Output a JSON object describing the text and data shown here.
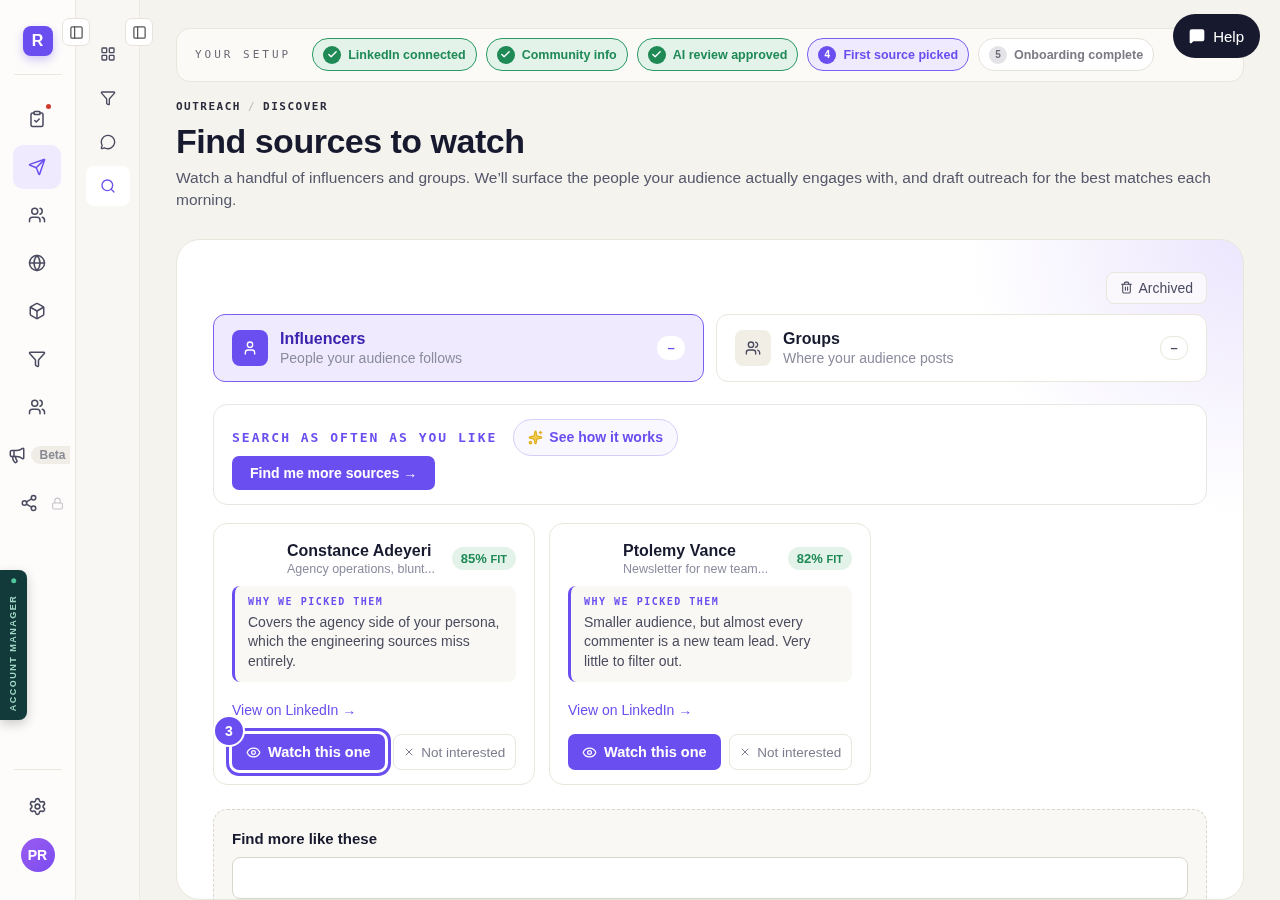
{
  "rail": {
    "logo": "R",
    "items": [
      {
        "selected": false,
        "notification": true,
        "locked": false
      },
      {
        "selected": true,
        "notification": false,
        "locked": false
      },
      {
        "selected": false,
        "notification": false,
        "locked": false
      },
      {
        "selected": false,
        "notification": false,
        "locked": false
      },
      {
        "selected": false,
        "notification": false,
        "locked": false
      },
      {
        "selected": false,
        "notification": false,
        "locked": false
      },
      {
        "selected": false,
        "notification": false,
        "locked": false
      },
      {
        "selected": false,
        "notification": false,
        "locked": false,
        "badge": "Beta"
      },
      {
        "selected": false,
        "notification": false,
        "locked": true
      }
    ],
    "avatar": "PR",
    "side_tab": "ACCOUNT MANAGER"
  },
  "subnav": {
    "items": [
      {
        "selected": false
      },
      {
        "selected": false
      },
      {
        "selected": false
      },
      {
        "selected": true
      }
    ]
  },
  "setup": {
    "label": "YOUR SETUP",
    "steps": [
      {
        "label": "LinkedIn connected",
        "done": true,
        "selected": false
      },
      {
        "label": "Community info",
        "done": true,
        "selected": false
      },
      {
        "label": "AI review approved",
        "done": true,
        "selected": false
      },
      {
        "number": "4",
        "label": "First source picked",
        "done": false,
        "selected": true
      },
      {
        "number": "5",
        "label": "Onboarding complete",
        "done": false,
        "selected": false
      }
    ]
  },
  "help": "Help",
  "breadcrumb": {
    "items": [
      "OUTREACH",
      "DISCOVER"
    ],
    "separator": "/"
  },
  "title": "Find sources to watch",
  "subtitle": "Watch a handful of influencers and groups. We’ll surface the people your audience actually engages with, and draft outreach for the best matches each morning.",
  "archived": "Archived",
  "source_types": [
    {
      "title": "Influencers",
      "subtitle": "People your audience follows",
      "count": "–",
      "selected": true
    },
    {
      "title": "Groups",
      "subtitle": "Where your audience posts",
      "count": "–",
      "selected": false
    }
  ],
  "search": {
    "label": "SEARCH AS OFTEN AS YOU LIKE",
    "how": "See how it works",
    "button": "Find me more sources →"
  },
  "cards": [
    {
      "name": "Constance Adeyeri",
      "subtitle": "Agency operations, blunt...",
      "fit": "85%",
      "fit_unit": "FIT",
      "reason_label": "WHY WE PICKED THEM",
      "reason": "Covers the agency side of your persona, which the engineering sources miss entirely.",
      "link": "View on LinkedIn →",
      "watch": "Watch this one",
      "dismiss": "Not interested",
      "tour_step": "3"
    },
    {
      "name": "Ptolemy Vance",
      "subtitle": "Newsletter for new team...",
      "fit": "82%",
      "fit_unit": "FIT",
      "reason_label": "WHY WE PICKED THEM",
      "reason": "Smaller audience, but almost every commenter is a new team lead. Very little to filter out.",
      "link": "View on LinkedIn →",
      "watch": "Watch this one",
      "dismiss": "Not interested"
    }
  ],
  "more": {
    "title": "Find more like these"
  }
}
